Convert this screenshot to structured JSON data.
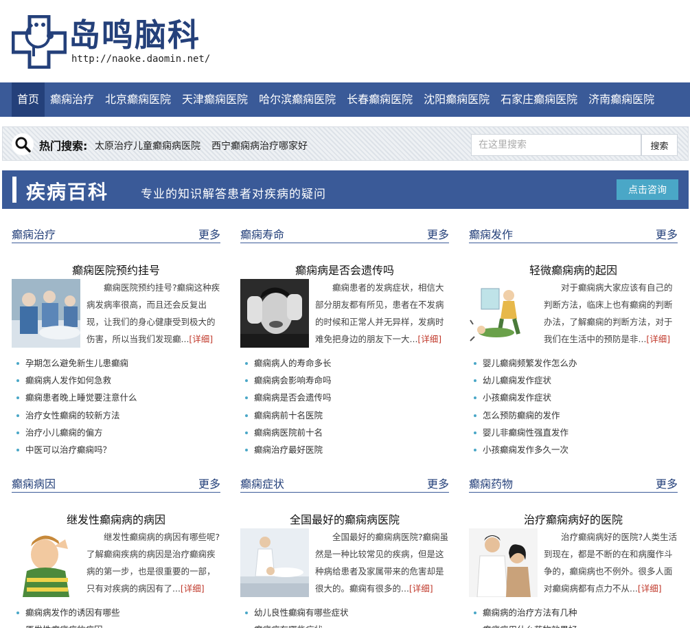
{
  "site": {
    "logo_text": "岛鸣脑科",
    "logo_url": "http://naoke.daomin.net/"
  },
  "nav": [
    {
      "label": "首页",
      "active": true
    },
    {
      "label": "癫痫治疗"
    },
    {
      "label": "北京癫痫医院"
    },
    {
      "label": "天津癫痫医院"
    },
    {
      "label": "哈尔滨癫痫医院"
    },
    {
      "label": "长春癫痫医院"
    },
    {
      "label": "沈阳癫痫医院"
    },
    {
      "label": "石家庄癫痫医院"
    },
    {
      "label": "济南癫痫医院"
    }
  ],
  "search": {
    "hot_label": "热门搜索:",
    "hot_links": [
      "太原治疗儿童癫痫病医院",
      "西宁癫痫病治疗哪家好"
    ],
    "placeholder": "在这里搜索",
    "button": "搜索"
  },
  "banner": {
    "title": "疾病百科",
    "subtitle": "专业的知识解答患者对疾病的疑问",
    "consult": "点击咨询"
  },
  "detail_label": "[详细]",
  "colors": {
    "brand": "#3a5a98",
    "brand_dark": "#24407a",
    "accent": "#4aa7c7",
    "link_red": "#c0392b"
  },
  "cards": [
    {
      "title": "癫痫治疗",
      "more": "更多",
      "feature_title": "癫痫医院预约挂号",
      "feature_text": "癫痫医院预约挂号?癫痫这种疾病发病率很高，而且还会反复出现，让我们的身心健康受到极大的伤害，所以当我们发现癫...",
      "image": "surgery-photo",
      "items": [
        "孕期怎么避免新生儿患癫痫",
        "癫痫病人发作如何急救",
        "癫痫患者晚上睡觉要注意什么",
        "治疗女性癫痫的较新方法",
        "治疗小儿癫痫的偏方",
        "中医可以治疗癫痫吗？"
      ]
    },
    {
      "title": "癫痫寿命",
      "more": "更多",
      "feature_title": "癫痫病是否会遗传吗",
      "feature_text": "癫痫患者的发病症状，相信大部分朋友都有所见，患者在不发病的时候和正常人并无异样，发病时难免把身边的朋友下一大...",
      "image": "distressed-man-photo",
      "items": [
        "癫痫病人的寿命多长",
        "癫痫病会影响寿命吗",
        "癫痫病是否会遗传吗",
        "癫痫病前十名医院",
        "癫痫病医院前十名",
        "癫痫治疗最好医院"
      ]
    },
    {
      "title": "癫痫发作",
      "more": "更多",
      "feature_title": "轻微癫痫病的起因",
      "feature_text": "对于癫痫病大家应该有自己的判断方法，临床上也有癫痫的判断办法，了解癫痫的判断方法，对于我们在生活中的预防是非...",
      "image": "seizure-illustration",
      "items": [
        "婴儿癫痫频繁发作怎么办",
        "幼儿癫痫发作症状",
        "小孩癫痫发作症状",
        "怎么预防癫痫的发作",
        "婴儿非癫痫性强直发作",
        "小孩癫痫发作多久一次"
      ]
    },
    {
      "title": "癫痫病因",
      "more": "更多",
      "feature_title": "继发性癫痫病的病因",
      "feature_text": "继发性癫痫病的病因有哪些呢?了解癫痫疾病的病因是治疗癫痫疾病的第一步，也是很重要的一部，只有对疾病的病因有了...",
      "image": "child-photo",
      "items": [
        "癫痫病发作的诱因有哪些",
        "原发性癫痫病的病因"
      ]
    },
    {
      "title": "癫痫症状",
      "more": "更多",
      "feature_title": "全国最好的癫痫病医院",
      "feature_text": "全国最好的癫痫病医院?癫痫虽然是一种比较常见的疾病，但是这种病给患者及家属带来的危害却是很大的。癫痫有很多的...",
      "image": "doctor-patient-photo",
      "items": [
        "幼儿良性癫痫有哪些症状",
        "癫痫病有哪些症状"
      ]
    },
    {
      "title": "癫痫药物",
      "more": "更多",
      "feature_title": "治疗癫痫病好的医院",
      "feature_text": "治疗癫痫病好的医院?人类生活到现在，都是不断的在和病魔作斗争的，癫痫病也不例外。很多人面对癫痫病都有点力不从...",
      "image": "doctor-woman-photo",
      "items": [
        "癫痫病的治疗方法有几种",
        "癫痫病用什么药物效果好"
      ]
    }
  ]
}
